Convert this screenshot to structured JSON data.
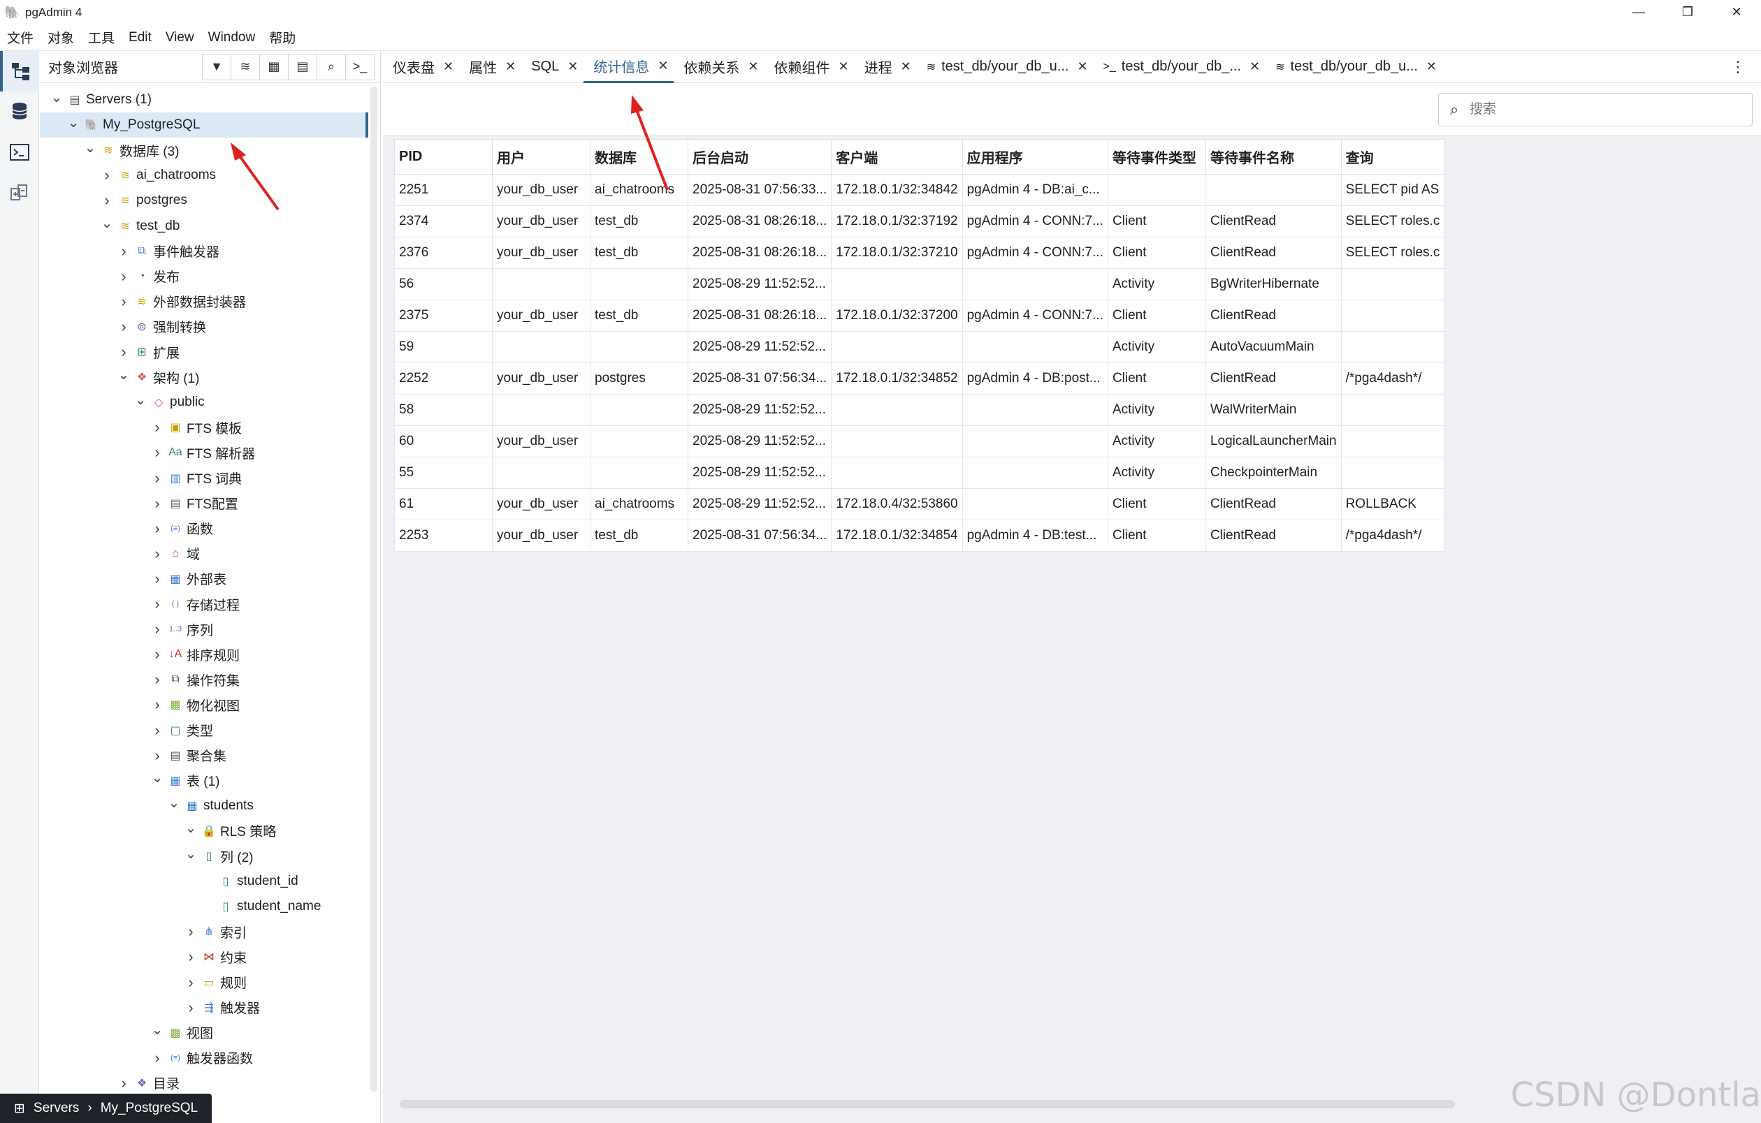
{
  "window": {
    "title": "pgAdmin 4",
    "minimize": "—",
    "restore": "❐",
    "close": "✕"
  },
  "menu": [
    "文件",
    "对象",
    "工具",
    "Edit",
    "View",
    "Window",
    "帮助"
  ],
  "browser": {
    "title": "对象浏览器",
    "tree": [
      {
        "label": "Servers (1)",
        "icon": "▤",
        "depth": 0,
        "chev": "v",
        "icon_color": "#555555"
      },
      {
        "label": "My_PostgreSQL",
        "icon": "🐘",
        "depth": 1,
        "chev": "v",
        "icon_color": "#336791",
        "selected": true
      },
      {
        "label": "数据库 (3)",
        "icon": "≋",
        "depth": 2,
        "chev": "v",
        "icon_color": "#c8a000"
      },
      {
        "label": "ai_chatrooms",
        "icon": "≋",
        "depth": 3,
        "chev": ">",
        "icon_color": "#c8a000"
      },
      {
        "label": "postgres",
        "icon": "≋",
        "depth": 3,
        "chev": ">",
        "icon_color": "#c8a000"
      },
      {
        "label": "test_db",
        "icon": "≋",
        "depth": 3,
        "chev": "v",
        "icon_color": "#c8a000"
      },
      {
        "label": "事件触发器",
        "icon": "⧉",
        "depth": 4,
        "chev": ">",
        "icon_color": "#3a7bd5"
      },
      {
        "label": "发布",
        "icon": "◔",
        "depth": 4,
        "chev": ">",
        "icon_color": "#5a5aa8"
      },
      {
        "label": "外部数据封装器",
        "icon": "≋",
        "depth": 4,
        "chev": ">",
        "icon_color": "#c8a000"
      },
      {
        "label": "强制转换",
        "icon": "⊚",
        "depth": 4,
        "chev": ">",
        "icon_color": "#7a5ab5"
      },
      {
        "label": "扩展",
        "icon": "⊞",
        "depth": 4,
        "chev": ">",
        "icon_color": "#2e8b57"
      },
      {
        "label": "架构 (1)",
        "icon": "❖",
        "depth": 4,
        "chev": "v",
        "icon_color": "#d9534f"
      },
      {
        "label": "public",
        "icon": "◇",
        "depth": 5,
        "chev": "v",
        "icon_color": "#d9534f"
      },
      {
        "label": "FTS 模板",
        "icon": "▣",
        "depth": 6,
        "chev": ">",
        "icon_color": "#c8a000"
      },
      {
        "label": "FTS 解析器",
        "icon": "Aa",
        "depth": 6,
        "chev": ">",
        "icon_color": "#2e8b57"
      },
      {
        "label": "FTS 词典",
        "icon": "▥",
        "depth": 6,
        "chev": ">",
        "icon_color": "#3a7bd5"
      },
      {
        "label": "FTS配置",
        "icon": "▤",
        "depth": 6,
        "chev": ">",
        "icon_color": "#666666"
      },
      {
        "label": "函数",
        "icon": "(≡)",
        "depth": 6,
        "chev": ">",
        "icon_color": "#3a7bd5"
      },
      {
        "label": "域",
        "icon": "⌂",
        "depth": 6,
        "chev": ">",
        "icon_color": "#c0392b"
      },
      {
        "label": "外部表",
        "icon": "▦",
        "depth": 6,
        "chev": ">",
        "icon_color": "#3a7bd5"
      },
      {
        "label": "存储过程",
        "icon": "( )",
        "depth": 6,
        "chev": ">",
        "icon_color": "#3a7bd5"
      },
      {
        "label": "序列",
        "icon": "1..3",
        "depth": 6,
        "chev": ">",
        "icon_color": "#7a5ab5"
      },
      {
        "label": "排序规则",
        "icon": "↓A",
        "depth": 6,
        "chev": ">",
        "icon_color": "#c0392b"
      },
      {
        "label": "操作符集",
        "icon": "⧉",
        "depth": 6,
        "chev": ">",
        "icon_color": "#555555"
      },
      {
        "label": "物化视图",
        "icon": "▩",
        "depth": 6,
        "chev": ">",
        "icon_color": "#7cb342"
      },
      {
        "label": "类型",
        "icon": "▢",
        "depth": 6,
        "chev": ">",
        "icon_color": "#2e8b57"
      },
      {
        "label": "聚合集",
        "icon": "▤",
        "depth": 6,
        "chev": ">",
        "icon_color": "#555555"
      },
      {
        "label": "表 (1)",
        "icon": "▦",
        "depth": 6,
        "chev": "v",
        "icon_color": "#3a7bd5"
      },
      {
        "label": "students",
        "icon": "▦",
        "depth": 7,
        "chev": "v",
        "icon_color": "#3a7bd5"
      },
      {
        "label": "RLS 策略",
        "icon": "🔒",
        "depth": 8,
        "chev": "v",
        "icon_color": "#2e8b57"
      },
      {
        "label": "列 (2)",
        "icon": "▯",
        "depth": 8,
        "chev": "v",
        "icon_color": "#2e8b57"
      },
      {
        "label": "student_id",
        "icon": "▯",
        "depth": 9,
        "chev": "",
        "icon_color": "#2e8b57"
      },
      {
        "label": "student_name",
        "icon": "▯",
        "depth": 9,
        "chev": "",
        "icon_color": "#2e8b57"
      },
      {
        "label": "索引",
        "icon": "⋔",
        "depth": 8,
        "chev": ">",
        "icon_color": "#3a7bd5"
      },
      {
        "label": "约束",
        "icon": "⋈",
        "depth": 8,
        "chev": ">",
        "icon_color": "#c0392b"
      },
      {
        "label": "规则",
        "icon": "▭",
        "depth": 8,
        "chev": ">",
        "icon_color": "#c8a000"
      },
      {
        "label": "触发器",
        "icon": "⇶",
        "depth": 8,
        "chev": ">",
        "icon_color": "#3a7bd5"
      },
      {
        "label": "视图",
        "icon": "▩",
        "depth": 6,
        "chev": "v",
        "icon_color": "#7cb342"
      },
      {
        "label": "触发器函数",
        "icon": "(≡)",
        "depth": 6,
        "chev": ">",
        "icon_color": "#3a7bd5"
      },
      {
        "label": "目录",
        "icon": "❖",
        "depth": 4,
        "chev": ">",
        "icon_color": "#7a5ab5"
      }
    ]
  },
  "breadcrumb": {
    "icon": "⊞",
    "items": [
      "Servers",
      "My_PostgreSQL"
    ],
    "separator": "›"
  },
  "tabs": [
    {
      "label": "仪表盘",
      "icon": ""
    },
    {
      "label": "属性",
      "icon": ""
    },
    {
      "label": "SQL",
      "icon": ""
    },
    {
      "label": "统计信息",
      "icon": "",
      "active": true
    },
    {
      "label": "依赖关系",
      "icon": ""
    },
    {
      "label": "依赖组件",
      "icon": ""
    },
    {
      "label": "进程",
      "icon": ""
    },
    {
      "label": "test_db/your_db_u...",
      "icon": "≋"
    },
    {
      "label": "test_db/your_db_...",
      "icon": ">_"
    },
    {
      "label": "test_db/your_db_u...",
      "icon": "≋"
    }
  ],
  "search": {
    "placeholder": "搜索"
  },
  "grid": {
    "columns": [
      "PID",
      "用户",
      "数据库",
      "后台启动",
      "客户端",
      "应用程序",
      "等待事件类型",
      "等待事件名称",
      "查询"
    ],
    "rows": [
      [
        "2251",
        "your_db_user",
        "ai_chatrooms",
        "2025-08-31 07:56:33...",
        "172.18.0.1/32:34842",
        "pgAdmin 4 - DB:ai_c...",
        "",
        "",
        "SELECT pid AS"
      ],
      [
        "2374",
        "your_db_user",
        "test_db",
        "2025-08-31 08:26:18...",
        "172.18.0.1/32:37192",
        "pgAdmin 4 - CONN:7...",
        "Client",
        "ClientRead",
        "SELECT roles.c"
      ],
      [
        "2376",
        "your_db_user",
        "test_db",
        "2025-08-31 08:26:18...",
        "172.18.0.1/32:37210",
        "pgAdmin 4 - CONN:7...",
        "Client",
        "ClientRead",
        "SELECT roles.c"
      ],
      [
        "56",
        "",
        "",
        "2025-08-29 11:52:52...",
        "",
        "",
        "Activity",
        "BgWriterHibernate",
        ""
      ],
      [
        "2375",
        "your_db_user",
        "test_db",
        "2025-08-31 08:26:18...",
        "172.18.0.1/32:37200",
        "pgAdmin 4 - CONN:7...",
        "Client",
        "ClientRead",
        ""
      ],
      [
        "59",
        "",
        "",
        "2025-08-29 11:52:52...",
        "",
        "",
        "Activity",
        "AutoVacuumMain",
        ""
      ],
      [
        "2252",
        "your_db_user",
        "postgres",
        "2025-08-31 07:56:34...",
        "172.18.0.1/32:34852",
        "pgAdmin 4 - DB:post...",
        "Client",
        "ClientRead",
        "/*pga4dash*/"
      ],
      [
        "58",
        "",
        "",
        "2025-08-29 11:52:52...",
        "",
        "",
        "Activity",
        "WalWriterMain",
        ""
      ],
      [
        "60",
        "your_db_user",
        "",
        "2025-08-29 11:52:52...",
        "",
        "",
        "Activity",
        "LogicalLauncherMain",
        ""
      ],
      [
        "55",
        "",
        "",
        "2025-08-29 11:52:52...",
        "",
        "",
        "Activity",
        "CheckpointerMain",
        ""
      ],
      [
        "61",
        "your_db_user",
        "ai_chatrooms",
        "2025-08-29 11:52:52...",
        "172.18.0.4/32:53860",
        "",
        "Client",
        "ClientRead",
        "ROLLBACK"
      ],
      [
        "2253",
        "your_db_user",
        "test_db",
        "2025-08-31 07:56:34...",
        "172.18.0.1/32:34854",
        "pgAdmin 4 - DB:test...",
        "Client",
        "ClientRead",
        "/*pga4dash*/"
      ]
    ]
  },
  "watermark": "CSDN @Dontla",
  "colors": {
    "accent": "#326690",
    "arrow": "#e02020"
  }
}
